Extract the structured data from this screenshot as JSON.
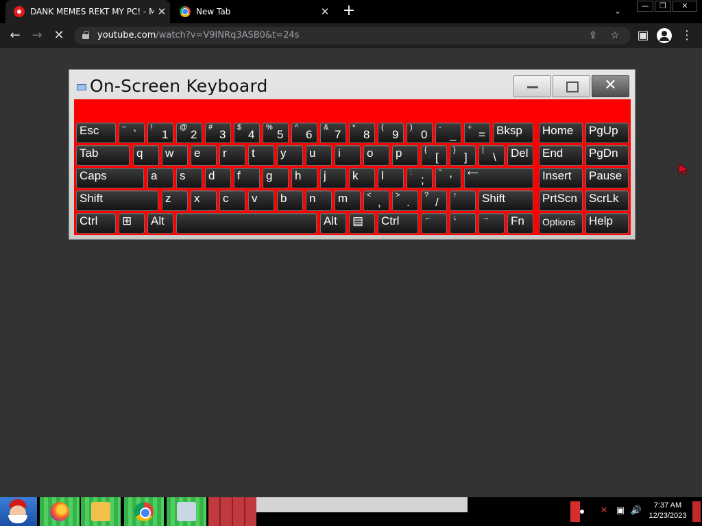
{
  "browser": {
    "tabs": [
      {
        "title": "DANK MEMES REKT MY PC! - ME",
        "favicon": "youtube-icon",
        "active": true
      },
      {
        "title": "New Tab",
        "favicon": "chrome-icon",
        "active": false
      }
    ],
    "new_tab_symbol": "+",
    "tab_search_symbol": "⌄",
    "window_controls": {
      "minimize": "—",
      "restore": "❐",
      "close": "✕"
    },
    "nav": {
      "back": "←",
      "forward": "→",
      "stop": "✕"
    },
    "url_host": "youtube.com",
    "url_rest": "/watch?v=V9INRq3ASB0&t=24s",
    "omnibox_icons": {
      "share": "⇪",
      "bookmark": "☆"
    },
    "side_panel": "▣",
    "menu": "⋮"
  },
  "osk": {
    "title": "On-Screen Keyboard",
    "close_symbol": "✕",
    "rows": [
      [
        {
          "type": "label",
          "text": "Esc"
        },
        {
          "type": "sym",
          "top": "~",
          "main": "`"
        },
        {
          "type": "sym",
          "top": "!",
          "main": "1"
        },
        {
          "type": "sym",
          "top": "@",
          "main": "2"
        },
        {
          "type": "sym",
          "top": "#",
          "main": "3"
        },
        {
          "type": "sym",
          "top": "$",
          "main": "4"
        },
        {
          "type": "sym",
          "top": "%",
          "main": "5"
        },
        {
          "type": "sym",
          "top": "^",
          "main": "6"
        },
        {
          "type": "sym",
          "top": "&",
          "main": "7"
        },
        {
          "type": "sym",
          "top": "*",
          "main": "8"
        },
        {
          "type": "sym",
          "top": "(",
          "main": "9"
        },
        {
          "type": "sym",
          "top": ")",
          "main": "0"
        },
        {
          "type": "sym",
          "top": "-",
          "main": "_"
        },
        {
          "type": "sym",
          "top": "+",
          "main": "="
        },
        {
          "type": "label",
          "text": "Bksp"
        },
        {
          "type": "label",
          "text": "Home"
        },
        {
          "type": "label",
          "text": "PgUp"
        }
      ],
      [
        {
          "type": "label",
          "text": "Tab"
        },
        {
          "type": "label",
          "text": "q"
        },
        {
          "type": "label",
          "text": "w"
        },
        {
          "type": "label",
          "text": "e"
        },
        {
          "type": "label",
          "text": "r"
        },
        {
          "type": "label",
          "text": "t"
        },
        {
          "type": "label",
          "text": "y"
        },
        {
          "type": "label",
          "text": "u"
        },
        {
          "type": "label",
          "text": "i"
        },
        {
          "type": "label",
          "text": "o"
        },
        {
          "type": "label",
          "text": "p"
        },
        {
          "type": "sym",
          "top": "{",
          "main": "["
        },
        {
          "type": "sym",
          "top": "}",
          "main": "]"
        },
        {
          "type": "sym",
          "top": "|",
          "main": "\\"
        },
        {
          "type": "label",
          "text": "Del"
        },
        {
          "type": "label",
          "text": "End"
        },
        {
          "type": "label",
          "text": "PgDn"
        }
      ],
      [
        {
          "type": "label",
          "text": "Caps"
        },
        {
          "type": "label",
          "text": "a"
        },
        {
          "type": "label",
          "text": "s"
        },
        {
          "type": "label",
          "text": "d"
        },
        {
          "type": "label",
          "text": "f"
        },
        {
          "type": "label",
          "text": "g"
        },
        {
          "type": "label",
          "text": "h"
        },
        {
          "type": "label",
          "text": "j"
        },
        {
          "type": "label",
          "text": "k"
        },
        {
          "type": "label",
          "text": "l"
        },
        {
          "type": "sym",
          "top": ":",
          "main": ";"
        },
        {
          "type": "sym",
          "top": "\"",
          "main": "'"
        },
        {
          "type": "sym",
          "top": "⟵",
          "main": ""
        },
        {
          "type": "label",
          "text": "Insert"
        },
        {
          "type": "label",
          "text": "Pause"
        }
      ],
      [
        {
          "type": "label",
          "text": "Shift"
        },
        {
          "type": "label",
          "text": "z"
        },
        {
          "type": "label",
          "text": "x"
        },
        {
          "type": "label",
          "text": "c"
        },
        {
          "type": "label",
          "text": "v"
        },
        {
          "type": "label",
          "text": "b"
        },
        {
          "type": "label",
          "text": "n"
        },
        {
          "type": "label",
          "text": "m"
        },
        {
          "type": "sym",
          "top": "<",
          "main": ","
        },
        {
          "type": "sym",
          "top": ">",
          "main": "."
        },
        {
          "type": "sym",
          "top": "?",
          "main": "/"
        },
        {
          "type": "sym",
          "top": "↑",
          "main": ""
        },
        {
          "type": "label",
          "text": "Shift"
        },
        {
          "type": "label",
          "text": "PrtScn"
        },
        {
          "type": "label",
          "text": "ScrLk"
        }
      ],
      [
        {
          "type": "label",
          "text": "Ctrl"
        },
        {
          "type": "label",
          "text": "⊞"
        },
        {
          "type": "label",
          "text": "Alt"
        },
        {
          "type": "label",
          "text": ""
        },
        {
          "type": "label",
          "text": "Alt"
        },
        {
          "type": "label",
          "text": "▤"
        },
        {
          "type": "label",
          "text": "Ctrl"
        },
        {
          "type": "sym",
          "top": "←",
          "main": ""
        },
        {
          "type": "sym",
          "top": "↓",
          "main": ""
        },
        {
          "type": "sym",
          "top": "→",
          "main": ""
        },
        {
          "type": "label",
          "text": "Fn"
        },
        {
          "type": "label",
          "text": "Options"
        },
        {
          "type": "label",
          "text": "Help"
        }
      ]
    ],
    "colors": {
      "keyboard_background": "#ff0000",
      "key": "#1e1e1e"
    }
  },
  "taskbar": {
    "clock_time": "7:37 AM",
    "clock_date": "12/23/2023",
    "apps": [
      "firefox-icon",
      "file-explorer-icon",
      "chrome-icon",
      "on-screen-keyboard-icon"
    ],
    "tray_icons": {
      "network_alert": "✕",
      "network": "▣",
      "volume": "🔊"
    }
  }
}
